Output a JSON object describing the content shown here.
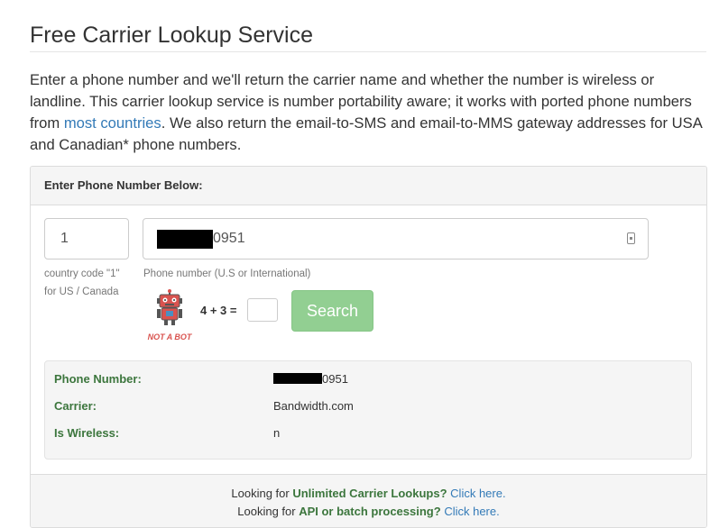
{
  "page": {
    "title": "Free Carrier Lookup Service"
  },
  "intro": {
    "text_1": "Enter a phone number and we'll return the carrier name and whether the number is wireless or landline. This carrier lookup service is number portability aware; it works with ported phone numbers from ",
    "link": "most countries",
    "text_2": ". We also return the email-to-SMS and email-to-MMS gateway addresses for USA and Canadian* phone numbers."
  },
  "form": {
    "header": "Enter Phone Number Below:",
    "country_code_value": "1",
    "country_code_help_1": "country code \"1\"",
    "country_code_help_2": "for US / Canada",
    "phone_value_visible_suffix": "0951",
    "phone_help": "Phone number (U.S or International)",
    "captcha_badge": "NOT A BOT",
    "captcha_question": "4 + 3 =",
    "captcha_answer": "",
    "search_label": "Search"
  },
  "results": {
    "phone_label": "Phone Number:",
    "phone_value_suffix": "0951",
    "carrier_label": "Carrier:",
    "carrier_value": "Bandwidth.com",
    "wireless_label": "Is Wireless:",
    "wireless_value": "n"
  },
  "footer": {
    "line1_prefix": "Looking for ",
    "line1_bold": "Unlimited Carrier Lookups?",
    "line1_link": "Click here.",
    "line2_prefix": "Looking for ",
    "line2_bold": "API or batch processing?",
    "line2_link": "Click here."
  },
  "colors": {
    "link": "#337ab7",
    "success_green": "#3c763d",
    "search_button": "#92cf92",
    "robot_red": "#d9534f"
  },
  "icons": [
    "robot-icon",
    "contact-card-icon"
  ]
}
